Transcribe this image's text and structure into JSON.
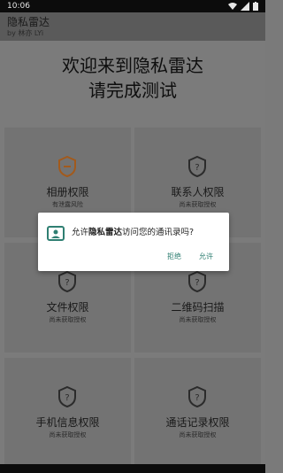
{
  "status": {
    "time": "10:06"
  },
  "appbar": {
    "title": "隐私雷达",
    "subtitle": "by 林亦 LYi"
  },
  "headline": {
    "line1": "欢迎来到隐私雷达",
    "line2": "请完成测试"
  },
  "cards": [
    {
      "label": "相册权限",
      "sub": "有泄露风险"
    },
    {
      "label": "联系人权限",
      "sub": "尚未获取授权"
    },
    {
      "label": "文件权限",
      "sub": "尚未获取授权"
    },
    {
      "label": "二维码扫描",
      "sub": "尚未获取授权"
    },
    {
      "label": "手机信息权限",
      "sub": "尚未获取授权"
    },
    {
      "label": "通话记录权限",
      "sub": "尚未获取授权"
    }
  ],
  "dialog": {
    "prefix": "允许",
    "app_name": "隐私雷达",
    "suffix": "访问您的通讯录吗?",
    "deny": "拒绝",
    "allow": "允许"
  },
  "colors": {
    "accent": "#2f7f72",
    "warning": "#a25a1c"
  }
}
